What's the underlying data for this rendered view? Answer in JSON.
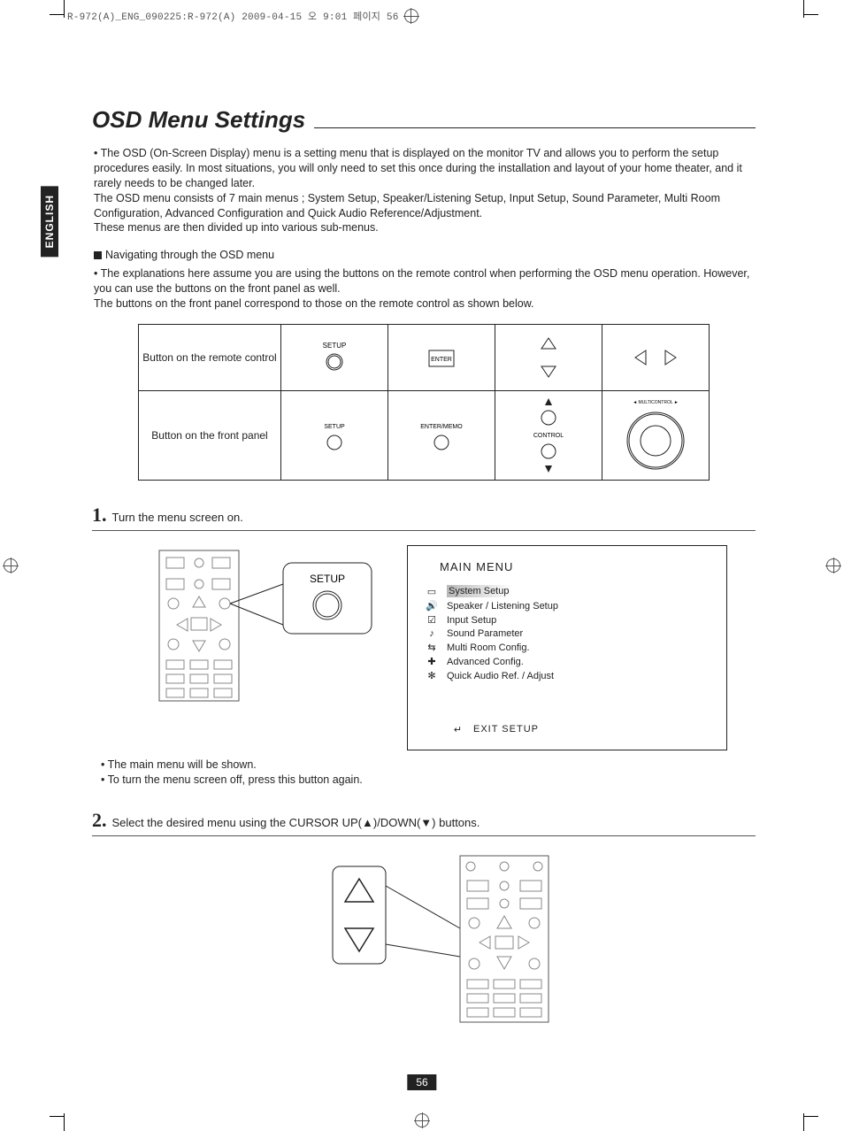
{
  "header_stamp": "R-972(A)_ENG_090225:R-972(A)  2009-04-15  오  9:01  페이지 56",
  "lang_tab": "ENGLISH",
  "title": "OSD Menu Settings",
  "intro": {
    "p1": "• The OSD (On-Screen Display) menu is a setting menu that is displayed on the monitor TV and allows you to perform the setup procedures easily. In most situations, you will only need to set this once during the installation and layout of your home theater, and it rarely needs to be changed later.",
    "p2": "The OSD menu consists of 7 main menus ; System Setup, Speaker/Listening Setup, Input Setup, Sound Parameter, Multi Room Configuration, Advanced Configuration and Quick Audio Reference/Adjustment.",
    "p3": "These menus are then divided up into various sub-menus."
  },
  "nav_heading": "Navigating through the OSD menu",
  "nav": {
    "p1": "• The explanations here assume you are using the buttons on the remote control when performing the OSD menu operation. However, you can use the buttons on the front panel as well.",
    "p2": "The buttons on the front panel correspond to those on the remote control as shown below."
  },
  "table": {
    "row1_label": "Button on the remote control",
    "row2_label": "Button on the front panel",
    "setup": "SETUP",
    "enter": "ENTER",
    "enter_memo": "ENTER/MEMO",
    "control": "CONTROL",
    "multicontrol": "MULTICONTROL"
  },
  "step1": {
    "num": "1.",
    "text": "Turn the menu screen on."
  },
  "setup_label": "SETUP",
  "osd": {
    "title": "MAIN MENU",
    "items": [
      "System Setup",
      "Speaker / Listening Setup",
      "Input Setup",
      "Sound Parameter",
      "Multi Room Config.",
      "Advanced Config.",
      "Quick Audio Ref. / Adjust"
    ],
    "exit": "EXIT SETUP"
  },
  "step1_notes": {
    "n1": "• The main menu will be shown.",
    "n2": "• To turn the menu screen off, press this button again."
  },
  "step2": {
    "num": "2.",
    "text": "Select the desired menu using the CURSOR UP(▲)/DOWN(▼) buttons."
  },
  "page_number": "56"
}
